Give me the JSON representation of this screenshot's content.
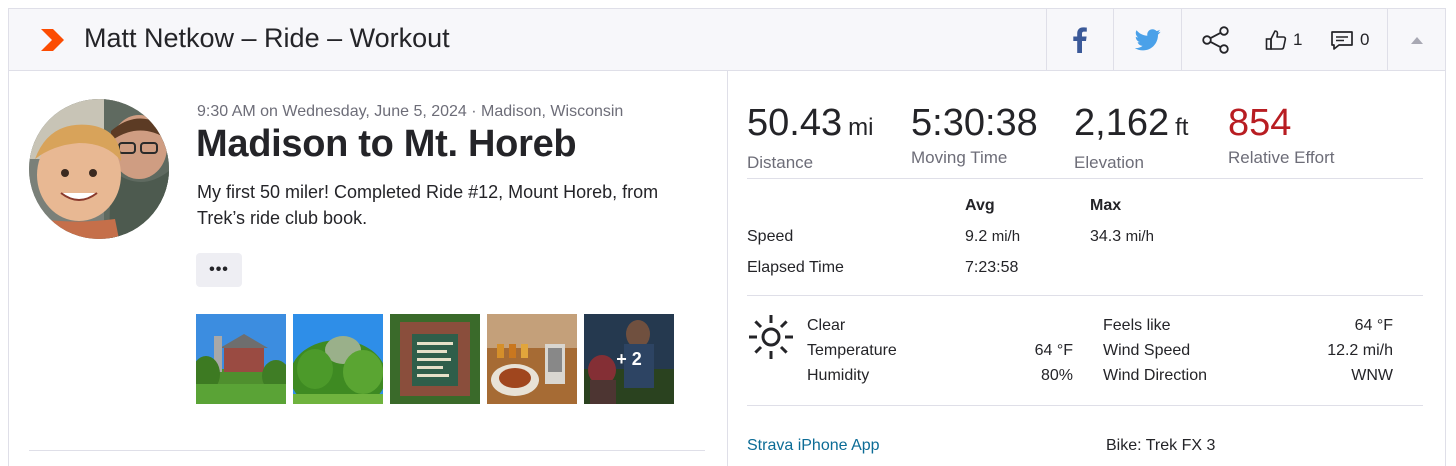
{
  "header": {
    "title": "Matt Netkow – Ride – Workout",
    "kudos_count": "1",
    "comment_count": "0",
    "brand_color": "#fc4c02"
  },
  "activity": {
    "meta": "9:30 AM on Wednesday, June 5, 2024 · Madison, Wisconsin",
    "title": "Madison to Mt. Horeb",
    "description": "My first 50 miler! Completed Ride #12, Mount Horeb, from Trek’s ride club book.",
    "more_label": "•••",
    "photos": [
      "barn-photo",
      "trees-photo",
      "sign-photo",
      "food-photo",
      "people-photo"
    ],
    "more_photos_label": "+ 2"
  },
  "stats": {
    "distance": {
      "value": "50.43",
      "unit": "mi",
      "label": "Distance"
    },
    "moving_time": {
      "value": "5:30:38",
      "label": "Moving Time"
    },
    "elevation": {
      "value": "2,162",
      "unit": "ft",
      "label": "Elevation"
    },
    "relative_effort": {
      "value": "854",
      "label": "Relative Effort",
      "color": "#b81d22"
    }
  },
  "details": {
    "avg_header": "Avg",
    "max_header": "Max",
    "speed_label": "Speed",
    "speed_avg": "9.2",
    "speed_avg_unit": "mi/h",
    "speed_max": "34.3",
    "speed_max_unit": "mi/h",
    "elapsed_label": "Elapsed Time",
    "elapsed_avg": "7:23:58"
  },
  "weather": {
    "condition": "Clear",
    "temperature_label": "Temperature",
    "temperature_value": "64 °F",
    "humidity_label": "Humidity",
    "humidity_value": "80%",
    "feels_like_label": "Feels like",
    "feels_like_value": "64 °F",
    "wind_speed_label": "Wind Speed",
    "wind_speed_value": "12.2 mi/h",
    "wind_direction_label": "Wind Direction",
    "wind_direction_value": "WNW"
  },
  "footer": {
    "device_link": "Strava iPhone App",
    "bike": "Bike: Trek FX 3"
  }
}
